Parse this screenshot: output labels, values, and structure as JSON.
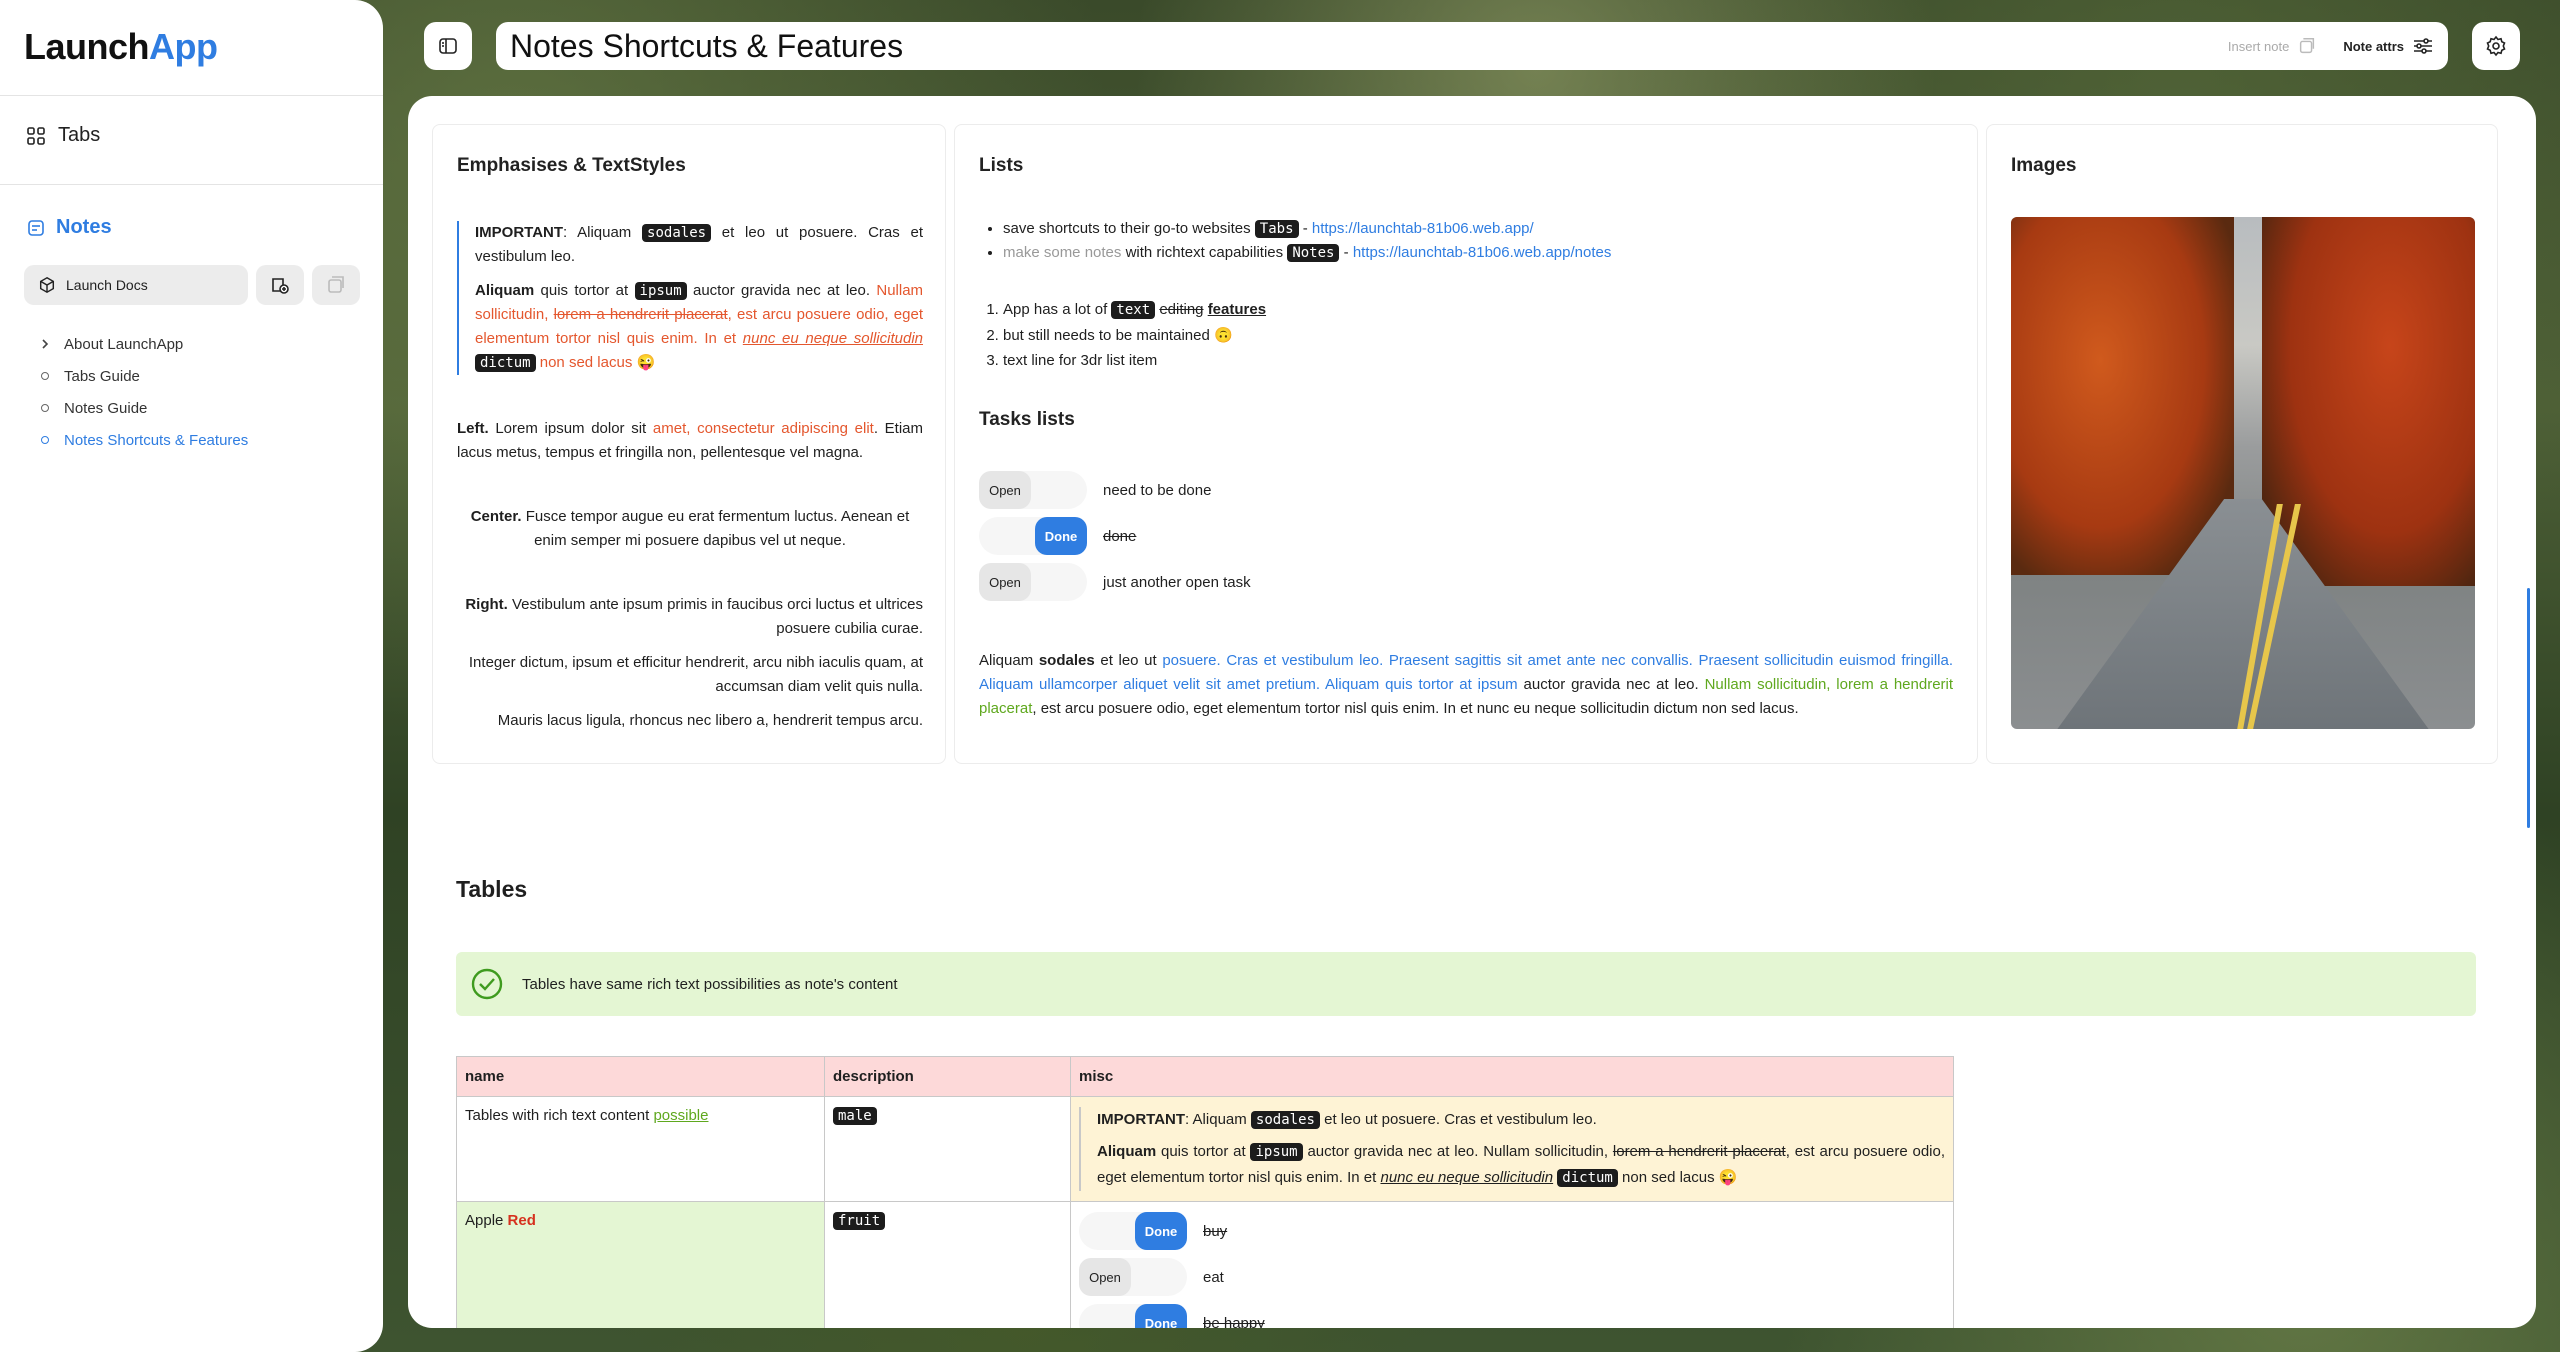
{
  "app": {
    "logo_main": "Launch",
    "logo_accent": "App"
  },
  "sidebar": {
    "tabs_label": "Tabs",
    "notes_label": "Notes",
    "launch_docs": "Launch Docs",
    "tree": [
      {
        "label": "About LaunchApp",
        "type": "chevron"
      },
      {
        "label": "Tabs Guide",
        "type": "dot"
      },
      {
        "label": "Notes Guide",
        "type": "dot"
      },
      {
        "label": "Notes Shortcuts & Features",
        "type": "dot",
        "active": true
      }
    ]
  },
  "header": {
    "title": "Notes Shortcuts & Features",
    "insert_note": "Insert note",
    "note_attrs": "Note attrs"
  },
  "emphasis": {
    "heading": "Emphasises & TextStyles",
    "q1_bold": "IMPORTANT",
    "q1_a": ": Aliquam",
    "q1_code": "sodales",
    "q1_b": "et leo ut posuere. Cras et vestibulum leo.",
    "q2_bold": "Aliquam",
    "q2_a": "quis tortor at",
    "q2_code": "ipsum",
    "q2_b": "auctor gravida nec at leo.",
    "q2_red": "Nullam sollicitudin,",
    "q2_strike": "lorem a hendrerit placerat",
    "q2_red2": ", est arcu posuere odio, eget elementum tortor nisl quis enim. In et",
    "q2_ul": "nunc eu neque sollicitudin",
    "q2_code2": "dictum",
    "q2_tail": "non sed lacus",
    "q2_emoji": "😜",
    "left_bold": "Left.",
    "left_a": "Lorem ipsum dolor sit",
    "left_red1": "amet,",
    "left_red2": "consectetur adipiscing elit",
    "left_b": ". Etiam lacus metus, tempus et fringilla non, pellentesque vel magna.",
    "center_bold": "Center.",
    "center_text": "Fusce tempor augue eu erat fermentum luctus. Aenean et enim semper mi posuere dapibus vel ut neque.",
    "right_bold": "Right.",
    "right_text": "Vestibulum ante ipsum primis in faucibus orci luctus et ultrices posuere cubilia curae.",
    "right2": "Integer dictum, ipsum et efficitur hendrerit, arcu nibh iaculis quam, at accumsan diam velit quis nulla.",
    "right3": "Mauris lacus ligula, rhoncus nec libero a, hendrerit tempus arcu."
  },
  "lists": {
    "heading": "Lists",
    "b1_a": "save shortcuts to their go-to websites",
    "b1_code": "Tabs",
    "b1_dash": "-",
    "b1_link": "https://launchtab-81b06.web.app/",
    "b2_grey": "make some notes",
    "b2_a": "with richtext capabilities",
    "b2_code": "Notes",
    "b2_dash": "-",
    "b2_link": "https://launchtab-81b06.web.app/notes",
    "o1_a": "App has a lot of",
    "o1_code": "text",
    "o1_strike": "editing",
    "o1_ul": "features",
    "o2": "but still needs to be maintained",
    "o2_emoji": "🙃",
    "o3": "text line for 3dr list item",
    "tasks_heading": "Tasks lists",
    "tasks": [
      {
        "state": "Open",
        "text": "need to be done"
      },
      {
        "state": "Done",
        "text": "done"
      },
      {
        "state": "Open",
        "text": "just another open task"
      }
    ],
    "p_a": "Aliquam",
    "p_bold": "sodales",
    "p_b": "et leo ut",
    "p_blue": "posuere. Cras et vestibulum leo. Praesent sagittis sit amet ante nec convallis. Praesent sollicitudin euismod fringilla. Aliquam ullamcorper aliquet velit sit amet pretium. Aliquam quis tortor at ipsum",
    "p_c": "auctor gravida nec at leo.",
    "p_green": "Nullam sollicitudin, lorem a hendrerit placerat",
    "p_d": ", est arcu posuere odio, eget elementum tortor nisl quis enim. In et nunc eu neque sollicitudin dictum non sed lacus."
  },
  "images": {
    "heading": "Images"
  },
  "tables": {
    "heading": "Tables",
    "callout": "Tables have same rich text possibilities as note's content",
    "headers": [
      "name",
      "description",
      "misc"
    ],
    "r1_name": "Tables with rich text content",
    "r1_link": "possible",
    "r1_code": "male",
    "r1_q1_bold": "IMPORTANT",
    "r1_q1_a": ": Aliquam",
    "r1_q1_code": "sodales",
    "r1_q1_b": "et leo ut posuere. Cras et vestibulum leo.",
    "r1_q2_bold": "Aliquam",
    "r1_q2_a": "quis tortor at",
    "r1_q2_code": "ipsum",
    "r1_q2_b": "auctor gravida nec at leo. Nullam sollicitudin,",
    "r1_q2_strike": "lorem a hendrerit placerat",
    "r1_q2_c": ", est arcu posuere odio, eget elementum tortor nisl quis enim. In et",
    "r1_q2_ul": "nunc eu neque sollicitudin",
    "r1_q2_code2": "dictum",
    "r1_q2_tail": "non sed lacus",
    "r1_q2_emoji": "😜",
    "r2_name": "Apple",
    "r2_red": "Red",
    "r2_code": "fruit",
    "r2_tasks": [
      {
        "state": "Done",
        "text": "buy"
      },
      {
        "state": "Open",
        "text": "eat"
      },
      {
        "state": "Done",
        "text": "be happy"
      }
    ]
  }
}
